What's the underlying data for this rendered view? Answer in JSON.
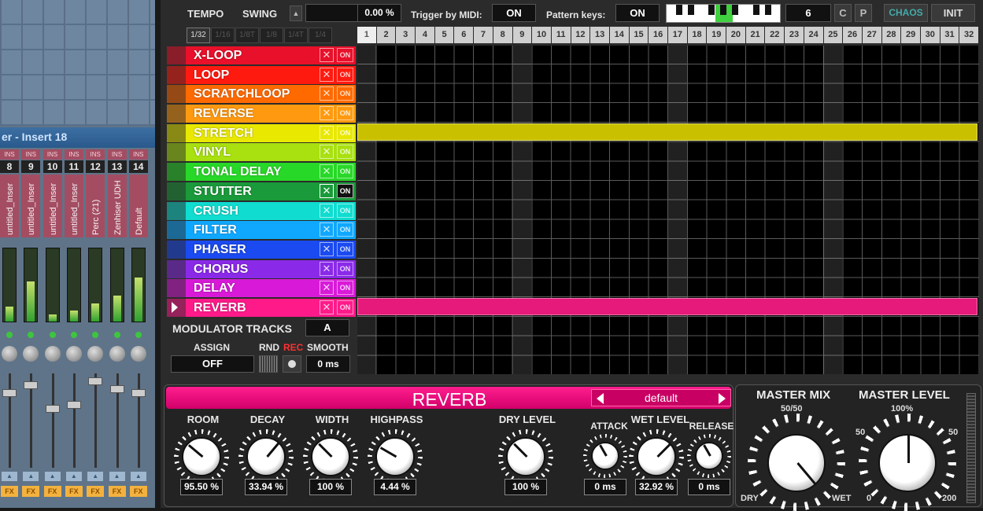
{
  "mixer": {
    "title": "er - Insert 18",
    "channels": [
      {
        "num": "8",
        "name": "untitled_Inser",
        "ins": "INS",
        "level": 0.2,
        "fx": "FX"
      },
      {
        "num": "9",
        "name": "untitled_Inser",
        "ins": "INS",
        "level": 0.55,
        "fx": "FX"
      },
      {
        "num": "10",
        "name": "untitled_Inser",
        "ins": "INS",
        "level": 0.1,
        "fx": "FX"
      },
      {
        "num": "11",
        "name": "untitled_Inser",
        "ins": "INS",
        "level": 0.15,
        "fx": "FX"
      },
      {
        "num": "12",
        "name": "Perc (21)",
        "ins": "INS",
        "level": 0.25,
        "fx": "FX"
      },
      {
        "num": "13",
        "name": "Zenhiser UDH",
        "ins": "INS",
        "level": 0.35,
        "fx": "FX"
      },
      {
        "num": "14",
        "name": "Default",
        "ins": "INS",
        "level": 0.6,
        "fx": "FX"
      }
    ]
  },
  "topbar": {
    "tempo": "TEMPO",
    "swing": "SWING",
    "swing_value": "0.00 %",
    "trigger_label": "Trigger by MIDI:",
    "trigger_value": "ON",
    "pattern_label": "Pattern keys:",
    "pattern_value": "ON",
    "pattern_number": "6",
    "c": "C",
    "p": "P",
    "chaos": "CHAOS",
    "init": "INIT"
  },
  "divisions": [
    "1/32",
    "1/16",
    "1/8T",
    "1/8",
    "1/4T",
    "1/4"
  ],
  "steps": [
    "1",
    "2",
    "3",
    "4",
    "5",
    "6",
    "7",
    "8",
    "9",
    "10",
    "11",
    "12",
    "13",
    "14",
    "15",
    "16",
    "17",
    "18",
    "19",
    "20",
    "21",
    "22",
    "23",
    "24",
    "25",
    "26",
    "27",
    "28",
    "29",
    "30",
    "31",
    "32"
  ],
  "tracks": [
    {
      "name": "X-LOOP",
      "color": "#e8102a",
      "x": "✕",
      "on": "ON"
    },
    {
      "name": "LOOP",
      "color": "#ff1a10",
      "x": "✕",
      "on": "ON"
    },
    {
      "name": "SCRATCHLOOP",
      "color": "#ff6a00",
      "x": "✕",
      "on": "ON"
    },
    {
      "name": "REVERSE",
      "color": "#ff9a10",
      "x": "✕",
      "on": "ON"
    },
    {
      "name": "STRETCH",
      "color": "#e8e800",
      "x": "✕",
      "on": "ON"
    },
    {
      "name": "VINYL",
      "color": "#a8e010",
      "x": "✕",
      "on": "ON"
    },
    {
      "name": "TONAL DELAY",
      "color": "#28d828",
      "x": "✕",
      "on": "ON"
    },
    {
      "name": "STUTTER",
      "color": "#1a9a3a",
      "x": "✕",
      "on": "ON"
    },
    {
      "name": "CRUSH",
      "color": "#10dcd0",
      "x": "✕",
      "on": "ON"
    },
    {
      "name": "FILTER",
      "color": "#10a8ff",
      "x": "✕",
      "on": "ON"
    },
    {
      "name": "PHASER",
      "color": "#1a4af0",
      "x": "✕",
      "on": "ON"
    },
    {
      "name": "CHORUS",
      "color": "#8a2ae8",
      "x": "✕",
      "on": "ON"
    },
    {
      "name": "DELAY",
      "color": "#d81ad8",
      "x": "✕",
      "on": "ON"
    },
    {
      "name": "REVERB",
      "color": "#ff1a8a",
      "x": "✕",
      "on": "ON"
    }
  ],
  "modulator": {
    "label": "MODULATOR TRACKS",
    "value": "A",
    "assign": "ASSIGN",
    "assign_value": "OFF",
    "rnd": "RND",
    "rec": "REC",
    "smooth": "SMOOTH",
    "smooth_value": "0 ms"
  },
  "effect": {
    "title": "REVERB",
    "preset": "default",
    "knobs": [
      {
        "label": "ROOM",
        "value": "95.50 %"
      },
      {
        "label": "DECAY",
        "value": "33.94 %"
      },
      {
        "label": "WIDTH",
        "value": "100 %"
      },
      {
        "label": "HIGHPASS",
        "value": "4.44 %"
      },
      {
        "label": "DRY LEVEL",
        "value": "100 %"
      },
      {
        "label": "ATTACK",
        "value": "0 ms"
      },
      {
        "label": "WET LEVEL",
        "value": "32.92 %"
      },
      {
        "label": "RELEASE",
        "value": "0 ms"
      }
    ]
  },
  "master": {
    "mix_label": "MASTER MIX",
    "mix_center": "50/50",
    "mix_left": "DRY",
    "mix_right": "WET",
    "level_label": "MASTER LEVEL",
    "level_top": "100%",
    "level_left_mid": "50",
    "level_right_mid": "50",
    "level_min": "0",
    "level_max": "200"
  }
}
